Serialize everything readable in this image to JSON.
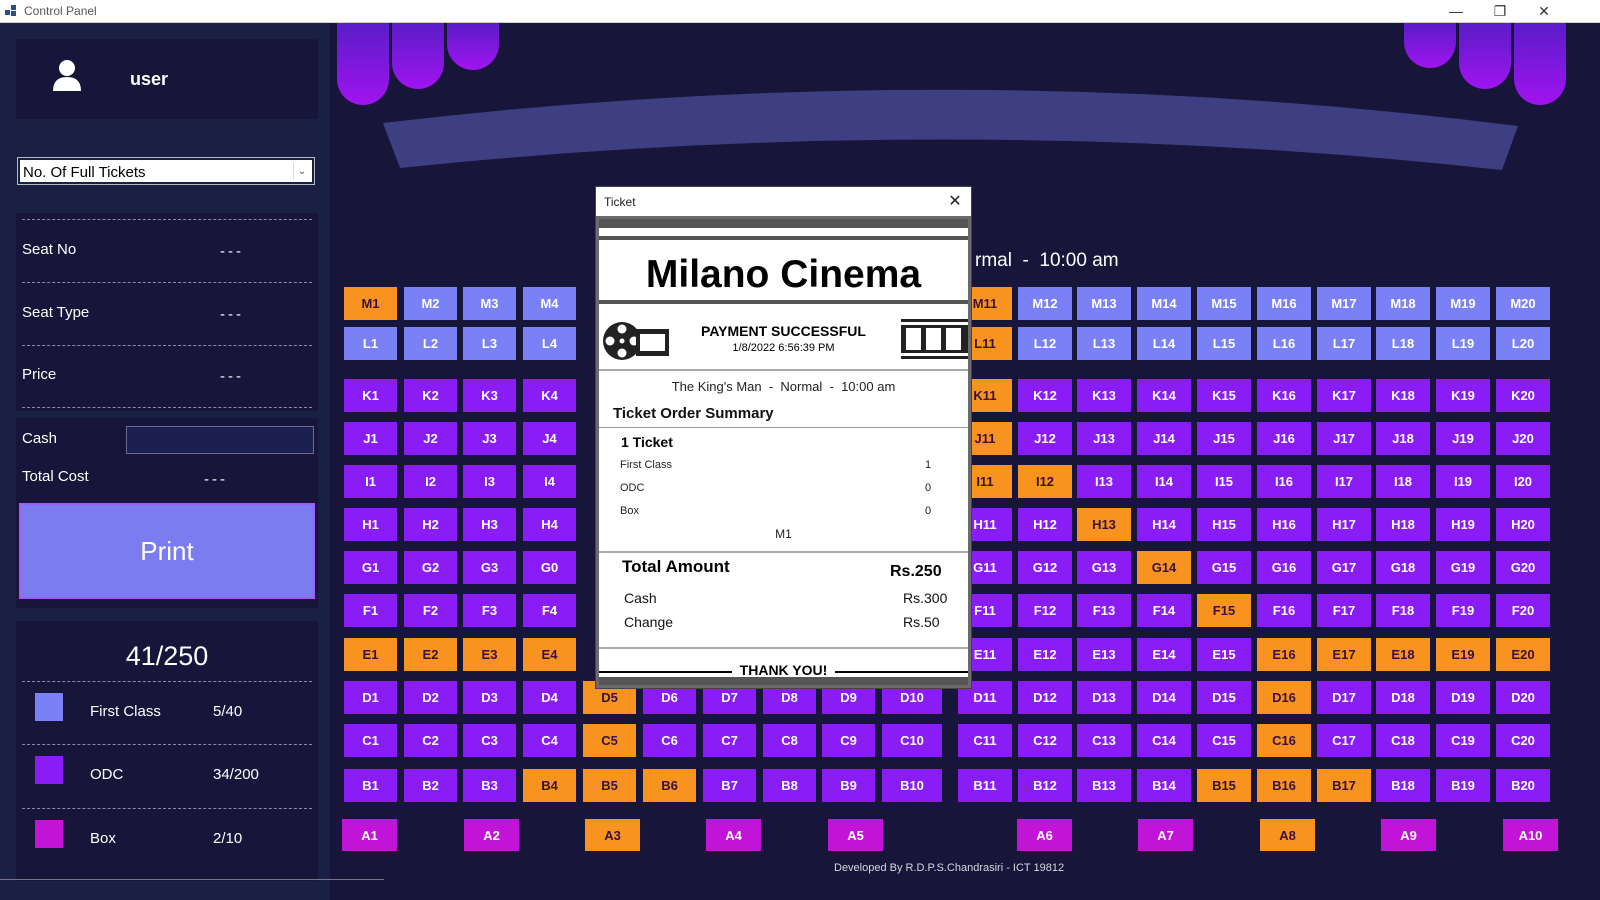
{
  "window": {
    "title": "Control Panel"
  },
  "sidebar": {
    "user_name": "user",
    "ticket_select": "No. Of Full Tickets",
    "seat_no_label": "Seat No",
    "seat_no_value": "---",
    "seat_type_label": "Seat Type",
    "seat_type_value": "---",
    "price_label": "Price",
    "price_value": "---",
    "cash_label": "Cash",
    "cash_value": "",
    "total_cost_label": "Total Cost",
    "total_cost_value": "---",
    "print_label": "Print",
    "stats_total": "41/250",
    "legend": [
      {
        "name": "First Class",
        "value": "5/40",
        "color": "#7a80f5"
      },
      {
        "name": "ODC",
        "value": "34/200",
        "color": "#8a1cf5"
      },
      {
        "name": "Box",
        "value": "2/10",
        "color": "#c214d8"
      }
    ]
  },
  "hall": {
    "movie_line_partial": "rmal  -  10:00 am",
    "footer": "Developed By R.D.P.S.Chandrasiri - ICT 19812",
    "colors": {
      "first_class": "#7a80f5",
      "odc": "#8a1cf5",
      "box": "#c214d8",
      "booked": "#f7931e"
    },
    "rows": [
      {
        "class": "fc",
        "seats": [
          {
            "label": "M1",
            "booked": true
          },
          {
            "label": "M2"
          },
          {
            "label": "M3"
          },
          {
            "label": "M4"
          },
          {
            "label": "M11",
            "booked": true
          },
          {
            "label": "M12"
          },
          {
            "label": "M13"
          },
          {
            "label": "M14"
          },
          {
            "label": "M15"
          },
          {
            "label": "M16"
          },
          {
            "label": "M17"
          },
          {
            "label": "M18"
          },
          {
            "label": "M19"
          },
          {
            "label": "M20"
          }
        ]
      },
      {
        "class": "fc",
        "seats": [
          {
            "label": "L1"
          },
          {
            "label": "L2"
          },
          {
            "label": "L3"
          },
          {
            "label": "L4"
          },
          {
            "label": "L11",
            "booked": true
          },
          {
            "label": "L12"
          },
          {
            "label": "L13"
          },
          {
            "label": "L14"
          },
          {
            "label": "L15"
          },
          {
            "label": "L16"
          },
          {
            "label": "L17"
          },
          {
            "label": "L18"
          },
          {
            "label": "L19"
          },
          {
            "label": "L20"
          }
        ]
      },
      {
        "class": "odc",
        "seats": [
          {
            "label": "K1"
          },
          {
            "label": "K2"
          },
          {
            "label": "K3"
          },
          {
            "label": "K4"
          },
          {
            "label": "K11",
            "booked": true
          },
          {
            "label": "K12"
          },
          {
            "label": "K13"
          },
          {
            "label": "K14"
          },
          {
            "label": "K15"
          },
          {
            "label": "K16"
          },
          {
            "label": "K17"
          },
          {
            "label": "K18"
          },
          {
            "label": "K19"
          },
          {
            "label": "K20"
          }
        ]
      },
      {
        "class": "odc",
        "seats": [
          {
            "label": "J1"
          },
          {
            "label": "J2"
          },
          {
            "label": "J3"
          },
          {
            "label": "J4"
          },
          {
            "label": "J11",
            "booked": true
          },
          {
            "label": "J12"
          },
          {
            "label": "J13"
          },
          {
            "label": "J14"
          },
          {
            "label": "J15"
          },
          {
            "label": "J16"
          },
          {
            "label": "J17"
          },
          {
            "label": "J18"
          },
          {
            "label": "J19"
          },
          {
            "label": "J20"
          }
        ]
      },
      {
        "class": "odc",
        "seats": [
          {
            "label": "I1"
          },
          {
            "label": "I2"
          },
          {
            "label": "I3"
          },
          {
            "label": "I4"
          },
          {
            "label": "I11",
            "booked": true
          },
          {
            "label": "I12",
            "booked": true
          },
          {
            "label": "I13"
          },
          {
            "label": "I14"
          },
          {
            "label": "I15"
          },
          {
            "label": "I16"
          },
          {
            "label": "I17"
          },
          {
            "label": "I18"
          },
          {
            "label": "I19"
          },
          {
            "label": "I20"
          }
        ]
      },
      {
        "class": "odc",
        "seats": [
          {
            "label": "H1"
          },
          {
            "label": "H2"
          },
          {
            "label": "H3"
          },
          {
            "label": "H4"
          },
          {
            "label": "H11"
          },
          {
            "label": "H12"
          },
          {
            "label": "H13",
            "booked": true
          },
          {
            "label": "H14"
          },
          {
            "label": "H15"
          },
          {
            "label": "H16"
          },
          {
            "label": "H17"
          },
          {
            "label": "H18"
          },
          {
            "label": "H19"
          },
          {
            "label": "H20"
          }
        ]
      },
      {
        "class": "odc",
        "seats": [
          {
            "label": "G1"
          },
          {
            "label": "G2"
          },
          {
            "label": "G3"
          },
          {
            "label": "G0"
          },
          {
            "label": "G11"
          },
          {
            "label": "G12"
          },
          {
            "label": "G13"
          },
          {
            "label": "G14",
            "booked": true
          },
          {
            "label": "G15"
          },
          {
            "label": "G16"
          },
          {
            "label": "G17"
          },
          {
            "label": "G18"
          },
          {
            "label": "G19"
          },
          {
            "label": "G20"
          }
        ]
      },
      {
        "class": "odc",
        "seats": [
          {
            "label": "F1"
          },
          {
            "label": "F2"
          },
          {
            "label": "F3"
          },
          {
            "label": "F4"
          },
          {
            "label": "F11"
          },
          {
            "label": "F12"
          },
          {
            "label": "F13"
          },
          {
            "label": "F14"
          },
          {
            "label": "F15",
            "booked": true
          },
          {
            "label": "F16"
          },
          {
            "label": "F17"
          },
          {
            "label": "F18"
          },
          {
            "label": "F19"
          },
          {
            "label": "F20"
          }
        ]
      },
      {
        "class": "odc",
        "seats": [
          {
            "label": "E1",
            "booked": true
          },
          {
            "label": "E2",
            "booked": true
          },
          {
            "label": "E3",
            "booked": true
          },
          {
            "label": "E4",
            "booked": true
          },
          {
            "label": "E11"
          },
          {
            "label": "E12"
          },
          {
            "label": "E13"
          },
          {
            "label": "E14"
          },
          {
            "label": "E15"
          },
          {
            "label": "E16",
            "booked": true
          },
          {
            "label": "E17",
            "booked": true
          },
          {
            "label": "E18",
            "booked": true
          },
          {
            "label": "E19",
            "booked": true
          },
          {
            "label": "E20",
            "booked": true
          }
        ]
      },
      {
        "class": "odc",
        "seats": [
          {
            "label": "D1"
          },
          {
            "label": "D2"
          },
          {
            "label": "D3"
          },
          {
            "label": "D4"
          },
          {
            "label": "D5",
            "booked": true
          },
          {
            "label": "D6"
          },
          {
            "label": "D7"
          },
          {
            "label": "D8"
          },
          {
            "label": "D9"
          },
          {
            "label": "D10"
          },
          {
            "label": "D11"
          },
          {
            "label": "D12"
          },
          {
            "label": "D13"
          },
          {
            "label": "D14"
          },
          {
            "label": "D15"
          },
          {
            "label": "D16",
            "booked": true
          },
          {
            "label": "D17"
          },
          {
            "label": "D18"
          },
          {
            "label": "D19"
          },
          {
            "label": "D20"
          }
        ]
      },
      {
        "class": "odc",
        "seats": [
          {
            "label": "C1"
          },
          {
            "label": "C2"
          },
          {
            "label": "C3"
          },
          {
            "label": "C4"
          },
          {
            "label": "C5",
            "booked": true
          },
          {
            "label": "C6"
          },
          {
            "label": "C7"
          },
          {
            "label": "C8"
          },
          {
            "label": "C9"
          },
          {
            "label": "C10"
          },
          {
            "label": "C11"
          },
          {
            "label": "C12"
          },
          {
            "label": "C13"
          },
          {
            "label": "C14"
          },
          {
            "label": "C15"
          },
          {
            "label": "C16",
            "booked": true
          },
          {
            "label": "C17"
          },
          {
            "label": "C18"
          },
          {
            "label": "C19"
          },
          {
            "label": "C20"
          }
        ]
      },
      {
        "class": "odc",
        "seats": [
          {
            "label": "B1"
          },
          {
            "label": "B2"
          },
          {
            "label": "B3"
          },
          {
            "label": "B4",
            "booked": true
          },
          {
            "label": "B5",
            "booked": true
          },
          {
            "label": "B6",
            "booked": true
          },
          {
            "label": "B7"
          },
          {
            "label": "B8"
          },
          {
            "label": "B9"
          },
          {
            "label": "B10"
          },
          {
            "label": "B11"
          },
          {
            "label": "B12"
          },
          {
            "label": "B13"
          },
          {
            "label": "B14"
          },
          {
            "label": "B15",
            "booked": true
          },
          {
            "label": "B16",
            "booked": true
          },
          {
            "label": "B17",
            "booked": true
          },
          {
            "label": "B18"
          },
          {
            "label": "B19"
          },
          {
            "label": "B20"
          }
        ]
      },
      {
        "class": "box",
        "seats": [
          {
            "label": "A1"
          },
          {
            "label": "A2"
          },
          {
            "label": "A3",
            "booked": true
          },
          {
            "label": "A4"
          },
          {
            "label": "A5"
          },
          {
            "label": "A6"
          },
          {
            "label": "A7"
          },
          {
            "label": "A8",
            "booked": true
          },
          {
            "label": "A9"
          },
          {
            "label": "A10"
          }
        ]
      }
    ]
  },
  "dialog": {
    "title": "Ticket",
    "cinema_name": "Milano Cinema",
    "status": "PAYMENT SUCCESSFUL",
    "datetime": "1/8/2022 6:56:39 PM",
    "movie_line": "The King's Man  -  Normal  -  10:00 am",
    "summary_title": "Ticket Order Summary",
    "ticket_count": "1 Ticket",
    "classes": [
      {
        "name": "First Class",
        "count": "1"
      },
      {
        "name": "ODC",
        "count": "0"
      },
      {
        "name": "Box",
        "count": "0"
      }
    ],
    "seat": "M1",
    "total_label": "Total Amount",
    "total_value": "Rs.250",
    "cash_label": "Cash",
    "cash_value": "Rs.300",
    "change_label": "Change",
    "change_value": "Rs.50",
    "thanks": "THANK YOU!"
  }
}
